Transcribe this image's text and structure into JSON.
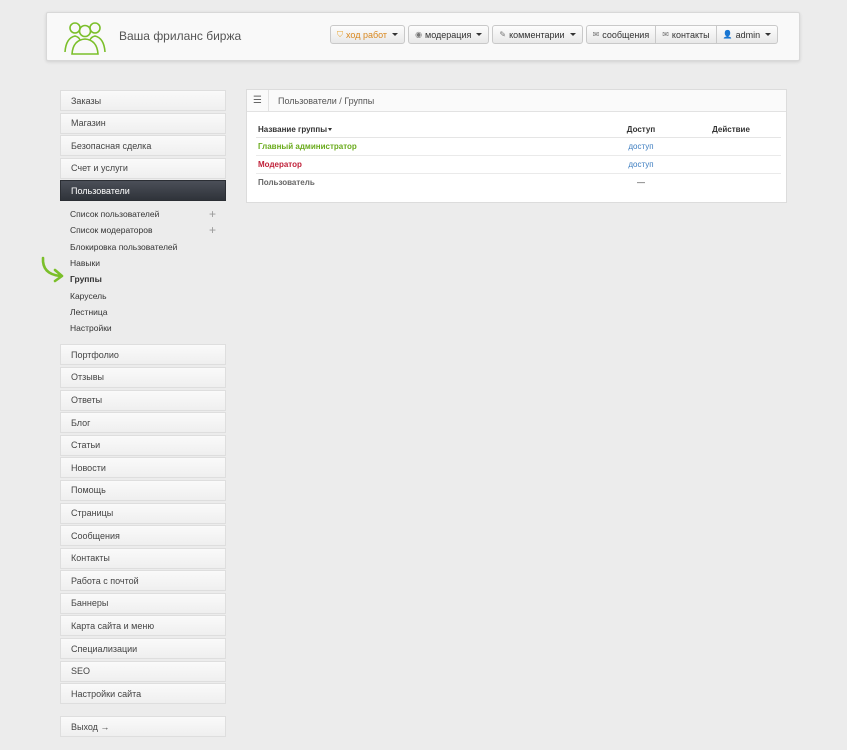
{
  "header": {
    "site_title": "Ваша фриланс биржа",
    "nav": {
      "progress": "ход работ",
      "moderation": "модерация",
      "comments": "комментарии",
      "messages": "сообщения",
      "contacts": "контакты",
      "user": "admin"
    }
  },
  "sidebar": {
    "top_items": [
      "Заказы",
      "Магазин",
      "Безопасная сделка",
      "Счет и услуги"
    ],
    "active": "Пользователи",
    "submenu": [
      "Список пользователей",
      "Список модераторов",
      "Блокировка пользователей",
      "Навыки",
      "Группы",
      "Карусель",
      "Лестница",
      "Настройки"
    ],
    "bottom_items": [
      "Портфолио",
      "Отзывы",
      "Ответы",
      "Блог",
      "Статьи",
      "Новости",
      "Помощь",
      "Страницы",
      "Сообщения",
      "Контакты",
      "Работа с почтой",
      "Баннеры",
      "Карта сайта и меню",
      "Специализации",
      "SEO",
      "Настройки сайта"
    ],
    "exit": "Выход →"
  },
  "panel": {
    "breadcrumb": "Пользователи / Группы",
    "columns": {
      "name": "Название группы",
      "access": "Доступ",
      "action": "Действие"
    },
    "rows": [
      {
        "name": "Главный администратор",
        "access": "доступ"
      },
      {
        "name": "Модератор",
        "access": "доступ"
      },
      {
        "name": "Пользователь",
        "access": "—"
      }
    ]
  },
  "colors": {
    "admin_group": "#6aab1c",
    "moderator_group": "#c0213a",
    "link": "#3a7bbf",
    "active_nav": "#3a3e45",
    "arrow": "#7bbf2a"
  }
}
